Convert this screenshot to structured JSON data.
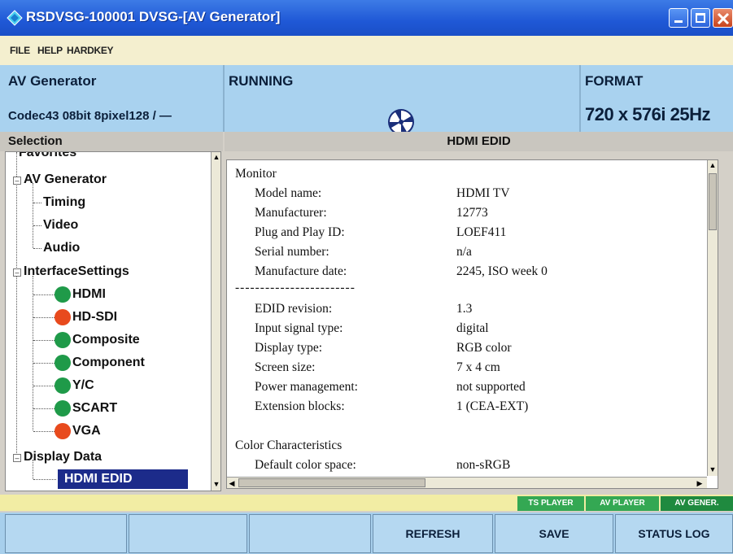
{
  "window": {
    "title": "RSDVSG-100001  DVSG-[AV Generator]"
  },
  "menu": [
    "FILE",
    "HELP",
    "HARDKEY"
  ],
  "info": {
    "generator_label": "AV Generator",
    "codec": "Codec43 08bit 8pixel128 / —",
    "status": "RUNNING",
    "format_label": "FORMAT",
    "format_value": "720 x 576i 25Hz"
  },
  "headers": {
    "selection": "Selection",
    "content": "HDMI EDID"
  },
  "tree": {
    "favorites": "Favorites",
    "av_generator": "AV Generator",
    "timing": "Timing",
    "video": "Video",
    "audio": "Audio",
    "interface_settings": "InterfaceSettings",
    "hdmi": "HDMI",
    "hd_sdi": "HD-SDI",
    "composite": "Composite",
    "component": "Component",
    "yc": "Y/C",
    "scart": "SCART",
    "vga": "VGA",
    "display_data": "Display Data",
    "hdmi_edid": "HDMI EDID"
  },
  "edid": {
    "section_monitor": "Monitor",
    "rows1": [
      {
        "key": "Model name:",
        "value": "HDMI TV"
      },
      {
        "key": "Manufacturer:",
        "value": "12773"
      },
      {
        "key": "Plug and Play ID:",
        "value": "LOEF411"
      },
      {
        "key": "Serial number:",
        "value": "n/a"
      },
      {
        "key": "Manufacture date:",
        "value": "2245, ISO week 0"
      }
    ],
    "separator": "------------------------",
    "rows2": [
      {
        "key": "EDID revision:",
        "value": "1.3"
      },
      {
        "key": "Input signal type:",
        "value": "digital"
      },
      {
        "key": "Display type:",
        "value": "RGB color"
      },
      {
        "key": "Screen size:",
        "value": "7 x 4 cm"
      },
      {
        "key": "Power management:",
        "value": "not supported"
      },
      {
        "key": "Extension blocks:",
        "value": "1 (CEA-EXT)"
      }
    ],
    "section_color": "Color Characteristics",
    "rows3": [
      {
        "key": "Default color space:",
        "value": "non-sRGB"
      }
    ]
  },
  "modes": [
    "TS PLAYER",
    "AV PLAYER",
    "AV GENER."
  ],
  "softkeys": [
    "",
    "",
    "",
    "REFRESH",
    "SAVE",
    "STATUS LOG"
  ],
  "colors": {
    "titlebar": "#1f58d6",
    "infobar": "#a9d2ef",
    "status_ok": "#1f9a49",
    "status_error": "#e84a1d",
    "selection": "#1c2b8a"
  }
}
